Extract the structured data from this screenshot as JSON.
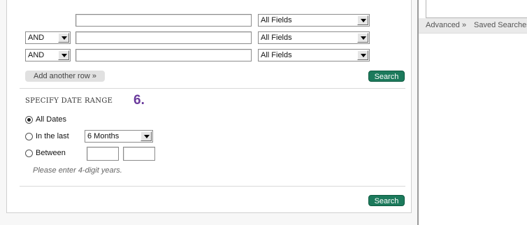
{
  "search_rows": [
    {
      "operator": "",
      "field": "All Fields",
      "query": ""
    },
    {
      "operator": "AND",
      "field": "All Fields",
      "query": ""
    },
    {
      "operator": "AND",
      "field": "All Fields",
      "query": ""
    }
  ],
  "add_row_label": "Add another row »",
  "search_label": "Search",
  "date_range": {
    "heading": "SPECIFY DATE RANGE",
    "step_number": "6.",
    "options": {
      "all_dates": "All Dates",
      "in_the_last": "In the last",
      "between": "Between"
    },
    "selected": "all_dates",
    "in_the_last_value": "6 Months",
    "between_from": "",
    "between_to": "",
    "hint": "Please enter 4-digit years."
  },
  "sidebar": {
    "advanced_link": "Advanced »",
    "saved_searches_link": "Saved Searches"
  }
}
